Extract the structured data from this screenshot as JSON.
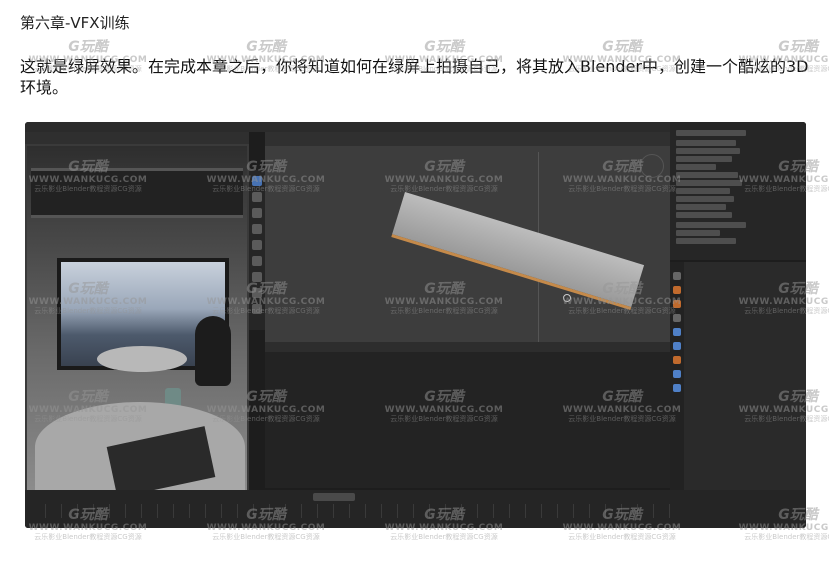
{
  "chapter_heading": "第六章-VFX训练",
  "paragraph": "这就是绿屏效果。在完成本章之后，你将知道如何在绿屏上拍摄自己，将其放入Blender中，创建一个酷炫的3D环境。",
  "watermark": {
    "logo": "G玩酷",
    "url": "WWW.WANKUCG.COM",
    "sub": "云乐影业Blender教程资源CG资源"
  },
  "colors": {
    "accent_blue": "#4772b3",
    "accent_orange": "#c58a4a",
    "panel_dark": "#1d1d1d"
  }
}
